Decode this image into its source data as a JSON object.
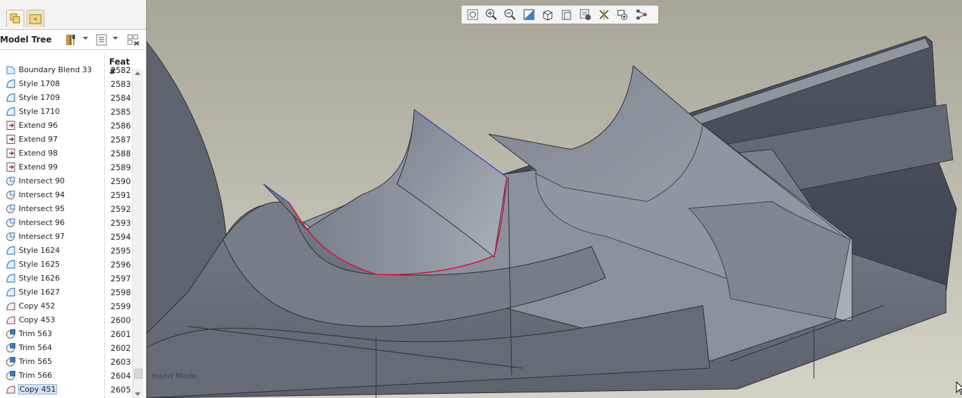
{
  "panel": {
    "title": "Model Tree",
    "feat_col_header": "Feat #",
    "tabs": [
      "layers-tab-icon",
      "favorites-tab-icon"
    ]
  },
  "tree_toolbar": {
    "settings": "tools-hammer-icon",
    "show": "tree-columns-icon",
    "filter": "tree-filter-icon"
  },
  "tree": [
    {
      "name": "Boundary Blend 33",
      "feat": "2582",
      "icon": "boundary-blend-icon"
    },
    {
      "name": "Style 1708",
      "feat": "2583",
      "icon": "style-feature-icon"
    },
    {
      "name": "Style 1709",
      "feat": "2584",
      "icon": "style-feature-icon"
    },
    {
      "name": "Style 1710",
      "feat": "2585",
      "icon": "style-feature-icon"
    },
    {
      "name": "Extend 96",
      "feat": "2586",
      "icon": "extend-icon"
    },
    {
      "name": "Extend 97",
      "feat": "2587",
      "icon": "extend-icon"
    },
    {
      "name": "Extend 98",
      "feat": "2588",
      "icon": "extend-icon"
    },
    {
      "name": "Extend 99",
      "feat": "2589",
      "icon": "extend-icon"
    },
    {
      "name": "Intersect 90",
      "feat": "2590",
      "icon": "intersect-icon"
    },
    {
      "name": "Intersect 94",
      "feat": "2591",
      "icon": "intersect-icon"
    },
    {
      "name": "Intersect 95",
      "feat": "2592",
      "icon": "intersect-icon"
    },
    {
      "name": "Intersect 96",
      "feat": "2593",
      "icon": "intersect-icon"
    },
    {
      "name": "Intersect 97",
      "feat": "2594",
      "icon": "intersect-icon"
    },
    {
      "name": "Style 1624",
      "feat": "2595",
      "icon": "style-feature-icon"
    },
    {
      "name": "Style 1625",
      "feat": "2596",
      "icon": "style-feature-icon"
    },
    {
      "name": "Style 1626",
      "feat": "2597",
      "icon": "style-feature-icon"
    },
    {
      "name": "Style 1627",
      "feat": "2598",
      "icon": "style-feature-icon"
    },
    {
      "name": "Copy 452",
      "feat": "2599",
      "icon": "copy-surface-icon"
    },
    {
      "name": "Copy 453",
      "feat": "2600",
      "icon": "copy-surface-icon"
    },
    {
      "name": "Trim 563",
      "feat": "2601",
      "icon": "trim-icon"
    },
    {
      "name": "Trim 564",
      "feat": "2602",
      "icon": "trim-icon"
    },
    {
      "name": "Trim 565",
      "feat": "2603",
      "icon": "trim-icon"
    },
    {
      "name": "Trim 566",
      "feat": "2604",
      "icon": "trim-icon"
    },
    {
      "name": "Copy 451",
      "feat": "2605",
      "icon": "copy-surface-icon",
      "selected": true
    }
  ],
  "view_toolbar": [
    "refit-icon",
    "zoom-in-icon",
    "zoom-out-icon",
    "repaint-icon",
    "display-style-icon",
    "saved-views-icon",
    "view-manager-icon",
    "datum-display-icon",
    "annotation-display-icon",
    "spin-center-icon"
  ],
  "status": {
    "mode": "Insert Mode"
  },
  "colors": {
    "highlight_curve": "#e01040",
    "preselect_edge": "#3344dd",
    "surface": "#8d949e",
    "viewport_bg_top": "#a9a597"
  }
}
